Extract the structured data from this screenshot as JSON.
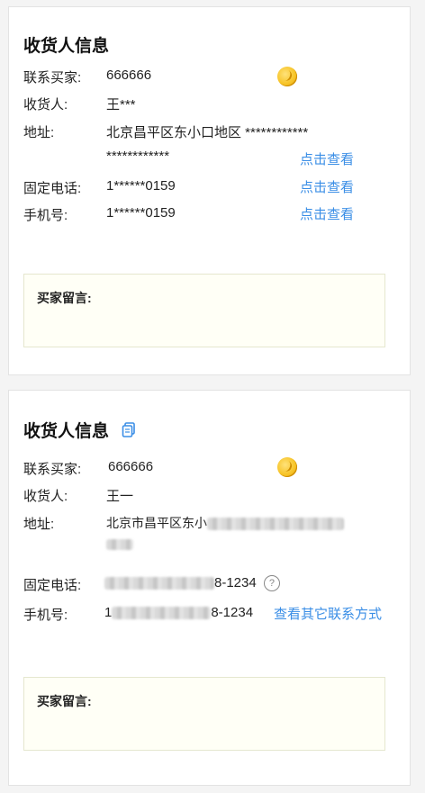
{
  "cards": [
    {
      "title": "收货人信息",
      "contact_label": "联系买家:",
      "contact_value": "666666",
      "receiver_label": "收货人:",
      "receiver_value": "王***",
      "address_label": "地址:",
      "address_line1": "北京昌平区东小口地区 ************",
      "address_line2": "************",
      "address_view_link": "点击查看",
      "phone_label": "固定电话:",
      "phone_value": "1******0159",
      "phone_view_link": "点击查看",
      "mobile_label": "手机号:",
      "mobile_value": "1******0159",
      "mobile_view_link": "点击查看",
      "message_label": "买家留言:"
    },
    {
      "title": "收货人信息",
      "contact_label": "联系买家:",
      "contact_value": "666666",
      "receiver_label": "收货人:",
      "receiver_value": "王一",
      "address_label": "地址:",
      "address_line1": "北京市昌平区东小",
      "phone_label": "固定电话:",
      "phone_value": "8-1234",
      "mobile_label": "手机号:",
      "mobile_prefix": "1",
      "mobile_value": "8-1234",
      "other_contact_link": "查看其它联系方式",
      "message_label": "买家留言:"
    }
  ],
  "icons": {
    "coin": "coin-icon",
    "copy": "copy-icon",
    "help": "help-icon",
    "help_glyph": "?"
  },
  "colors": {
    "link": "#3a8ee6",
    "message_bg": "#fffff6",
    "coin": "#f7c52a"
  }
}
